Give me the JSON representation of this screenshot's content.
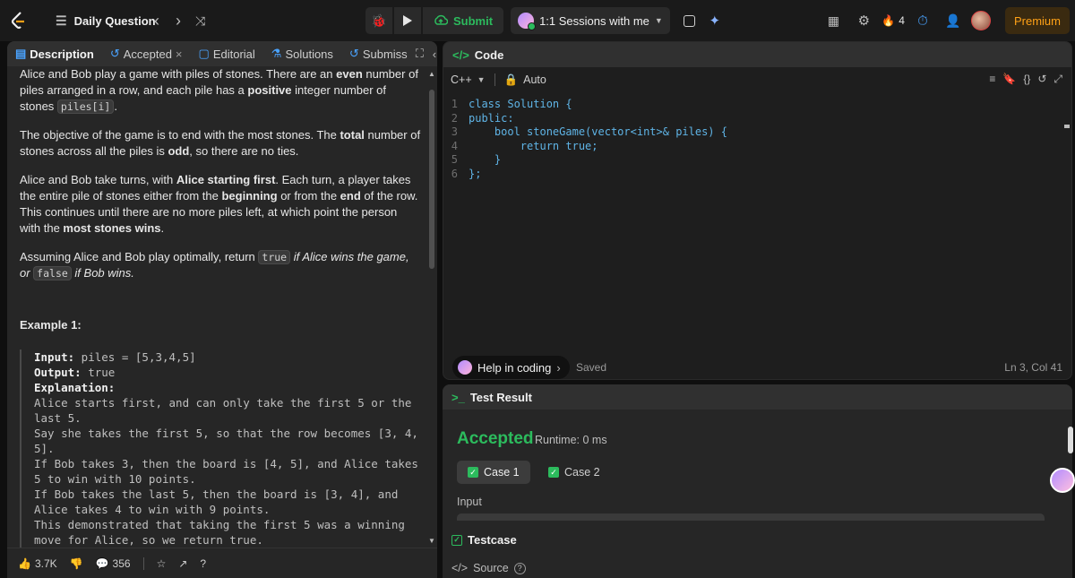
{
  "topbar": {
    "title": "Daily Question",
    "submit_label": "Submit",
    "sessions_label": "1:1 Sessions with me",
    "streak_count": "4",
    "premium_label": "Premium",
    "icons": [
      "logo-icon",
      "list-icon",
      "chevron-left-icon",
      "chevron-right-icon",
      "shuffle-icon",
      "debug-icon",
      "play-icon",
      "upload-icon",
      "note-icon",
      "sparkle-icon",
      "layout-icon",
      "gear-icon",
      "fire-icon",
      "timer-icon",
      "add-user-icon"
    ]
  },
  "left": {
    "tabs": [
      {
        "label": "Description",
        "icon": "document-icon"
      },
      {
        "label": "Accepted",
        "icon": "history-icon",
        "close": "×"
      },
      {
        "label": "Editorial",
        "icon": "book-icon"
      },
      {
        "label": "Solutions",
        "icon": "flask-icon"
      },
      {
        "label": "Submiss",
        "icon": "history-icon"
      }
    ],
    "paragraphs": {
      "p1_a": "Alice and Bob play a game with piles of stones. There are an ",
      "p1_b": "even",
      "p1_c": " number of piles arranged in a row, and each pile has a ",
      "p1_d": "positive",
      "p1_e": " integer number of stones ",
      "p1_code": "piles[i]",
      "p1_f": ".",
      "p2_a": "The objective of the game is to end with the most stones. The ",
      "p2_b": "total",
      "p2_c": " number of stones across all the piles is ",
      "p2_d": "odd",
      "p2_e": ", so there are no ties.",
      "p3_a": "Alice and Bob take turns, with ",
      "p3_b": "Alice starting first",
      "p3_c": ". Each turn, a player takes the entire pile of stones either from the ",
      "p3_d": "beginning",
      "p3_e": " or from the ",
      "p3_f": "end",
      "p3_g": " of the row. This continues until there are no more piles left, at which point the person with the ",
      "p3_h": "most stones wins",
      "p3_i": ".",
      "p4_a": "Assuming Alice and Bob play optimally, return ",
      "p4_code1": "true",
      "p4_b": " if Alice wins the game, or ",
      "p4_code2": "false",
      "p4_c": " if Bob wins."
    },
    "example": {
      "title": "Example 1:",
      "input_label": "Input:",
      "input_value": " piles = [5,3,4,5]",
      "output_label": "Output:",
      "output_value": " true",
      "explanation_label": "Explanation:",
      "lines": [
        "Alice starts first, and can only take the first 5 or the last 5.",
        "Say she takes the first 5, so that the row becomes [3, 4, 5].",
        "If Bob takes 3, then the board is [4, 5], and Alice takes 5 to win with 10 points.",
        "If Bob takes the last 5, then the board is [3, 4], and Alice takes 4 to win with 9 points.",
        "This demonstrated that taking the first 5 was a winning move for Alice, so we return true."
      ]
    },
    "footer": {
      "likes": "3.7K",
      "comments": "356"
    }
  },
  "code": {
    "header": "Code",
    "language": "C++",
    "mode": "Auto",
    "lines": [
      {
        "n": "1",
        "text": "class Solution {"
      },
      {
        "n": "2",
        "text": "public:"
      },
      {
        "n": "3",
        "text": "    bool stoneGame(vector<int>& piles) {"
      },
      {
        "n": "4",
        "text": "        return true;"
      },
      {
        "n": "5",
        "text": "    }"
      },
      {
        "n": "6",
        "text": "};"
      }
    ],
    "help_label": "Help in coding",
    "saved": "Saved",
    "cursor": "Ln 3, Col 41"
  },
  "result": {
    "header": "Test Result",
    "status": "Accepted",
    "runtime": "Runtime: 0 ms",
    "case1": "Case 1",
    "case2": "Case 2",
    "input_label": "Input",
    "testcase_label": "Testcase",
    "source_label": "Source"
  },
  "colors": {
    "accent_green": "#2cbb5d",
    "premium_orange": "#ffa116"
  }
}
